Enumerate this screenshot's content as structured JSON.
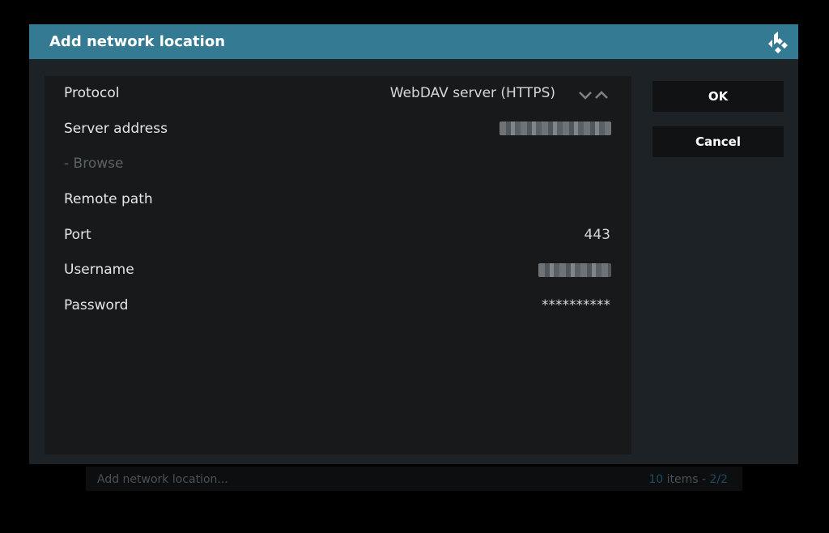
{
  "background": {
    "footer_label": "Add network location...",
    "footer_count_num": "10",
    "footer_count_text": " items - ",
    "footer_page": "2/2"
  },
  "dialog": {
    "title": "Add network location",
    "logo_icon": "kodi-logo-icon"
  },
  "settings": [
    {
      "label": "Protocol",
      "value": "WebDAV server (HTTPS)",
      "enabled": true
    },
    {
      "label": "Server address",
      "value": "",
      "enabled": true
    },
    {
      "label": "- Browse",
      "value": "",
      "enabled": false
    },
    {
      "label": "Remote path",
      "value": "",
      "enabled": true
    },
    {
      "label": "Port",
      "value": "443",
      "enabled": true
    },
    {
      "label": "Username",
      "value": "",
      "enabled": true
    },
    {
      "label": "Password",
      "value": "**********",
      "enabled": true
    }
  ],
  "buttons": {
    "ok": "OK",
    "cancel": "Cancel"
  },
  "colors": {
    "title_bar": "#347a93",
    "dialog_bg": "#1c2225",
    "list_bg": "#17191b"
  }
}
